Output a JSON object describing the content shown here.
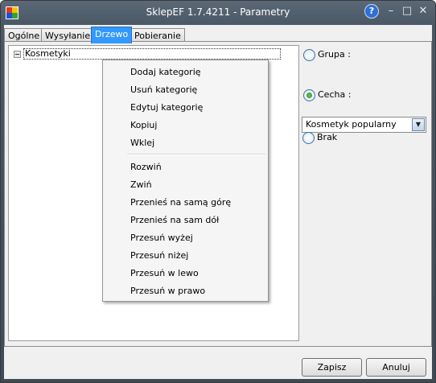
{
  "window": {
    "title": "SklepEF 1.7.4211 - Parametry",
    "help": "?",
    "minimize": "–",
    "maximize": "□",
    "close": "✕"
  },
  "tabs": [
    {
      "label": "Ogólne"
    },
    {
      "label": "Wysyłanie"
    },
    {
      "label": "Drzewo",
      "active": true
    },
    {
      "label": "Pobieranie"
    }
  ],
  "tree": {
    "root_label": "Kosmetyki"
  },
  "options": {
    "grupa_label": "Grupa :",
    "cecha_label": "Cecha :",
    "cecha_selected": "Kosmetyk popularny",
    "brak_label": "Brak",
    "selected": "cecha"
  },
  "context_menu": {
    "items": [
      "Dodaj kategorię",
      "Usuń kategorię",
      "Edytuj kategorię",
      "Kopiuj",
      "Wklej",
      "Rozwiń",
      "Zwiń",
      "Przenieś na samą górę",
      "Przenieś na sam dół",
      "Przesuń wyżej",
      "Przesuń niżej",
      "Przesuń w lewo",
      "Przesuń w prawo"
    ]
  },
  "buttons": {
    "save": "Zapisz",
    "cancel": "Anuluj"
  },
  "colors": {
    "tab_active": "#3399ff",
    "titlebar": "#4a5866",
    "radio_checked": "#1f8a18"
  }
}
